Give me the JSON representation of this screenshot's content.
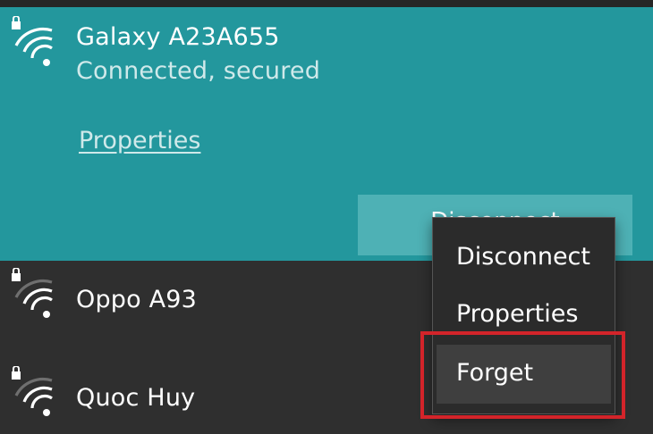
{
  "active_network": {
    "name": "Galaxy A23A655",
    "status": "Connected, secured",
    "properties_link": "Properties",
    "disconnect_button": "Disconnect",
    "icon": "wifi-secured-icon",
    "accent_color": "#23979d"
  },
  "networks": [
    {
      "name": "Oppo A93",
      "icon": "wifi-secured-icon"
    },
    {
      "name": "Quoc Huy",
      "icon": "wifi-secured-icon"
    }
  ],
  "context_menu": {
    "items": [
      {
        "label": "Disconnect"
      },
      {
        "label": "Properties"
      },
      {
        "label": "Forget"
      }
    ],
    "highlight_color": "#d3242a"
  }
}
